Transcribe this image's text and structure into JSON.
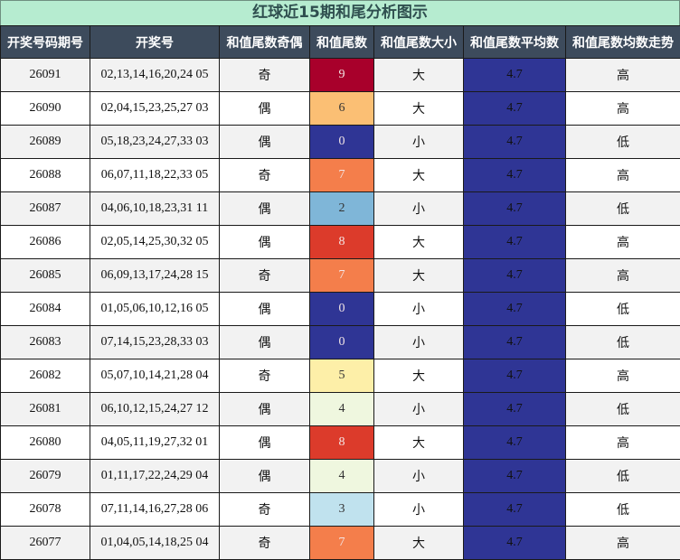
{
  "title": "红球近15期和尾分析图示",
  "headers": [
    "开奖号码期号",
    "开奖号",
    "和值尾数奇偶",
    "和值尾数",
    "和值尾数大小",
    "和值尾数平均数",
    "和值尾数均数走势"
  ],
  "colors": {
    "title_bg": "#b6ecd0",
    "header_bg": "#3d4b5c",
    "avg_bg": "#2f3595",
    "tail_scale": {
      "0": "#2f3595",
      "2": "#7fb6d8",
      "3": "#c0e2ee",
      "4": "#eff7df",
      "5": "#fdefa8",
      "6": "#fbbf74",
      "7": "#f47e4b",
      "8": "#dc3b2b",
      "9": "#a8002b"
    }
  },
  "rows": [
    {
      "issue": "26091",
      "numbers": "02,13,14,16,20,24 05",
      "parity": "奇",
      "tail": "9",
      "size": "大",
      "avg": "4.7",
      "trend": "高"
    },
    {
      "issue": "26090",
      "numbers": "02,04,15,23,25,27 03",
      "parity": "偶",
      "tail": "6",
      "size": "大",
      "avg": "4.7",
      "trend": "高"
    },
    {
      "issue": "26089",
      "numbers": "05,18,23,24,27,33 03",
      "parity": "偶",
      "tail": "0",
      "size": "小",
      "avg": "4.7",
      "trend": "低"
    },
    {
      "issue": "26088",
      "numbers": "06,07,11,18,22,33 05",
      "parity": "奇",
      "tail": "7",
      "size": "大",
      "avg": "4.7",
      "trend": "高"
    },
    {
      "issue": "26087",
      "numbers": "04,06,10,18,23,31 11",
      "parity": "偶",
      "tail": "2",
      "size": "小",
      "avg": "4.7",
      "trend": "低"
    },
    {
      "issue": "26086",
      "numbers": "02,05,14,25,30,32 05",
      "parity": "偶",
      "tail": "8",
      "size": "大",
      "avg": "4.7",
      "trend": "高"
    },
    {
      "issue": "26085",
      "numbers": "06,09,13,17,24,28 15",
      "parity": "奇",
      "tail": "7",
      "size": "大",
      "avg": "4.7",
      "trend": "高"
    },
    {
      "issue": "26084",
      "numbers": "01,05,06,10,12,16 05",
      "parity": "偶",
      "tail": "0",
      "size": "小",
      "avg": "4.7",
      "trend": "低"
    },
    {
      "issue": "26083",
      "numbers": "07,14,15,23,28,33 03",
      "parity": "偶",
      "tail": "0",
      "size": "小",
      "avg": "4.7",
      "trend": "低"
    },
    {
      "issue": "26082",
      "numbers": "05,07,10,14,21,28 04",
      "parity": "奇",
      "tail": "5",
      "size": "大",
      "avg": "4.7",
      "trend": "高"
    },
    {
      "issue": "26081",
      "numbers": "06,10,12,15,24,27 12",
      "parity": "偶",
      "tail": "4",
      "size": "小",
      "avg": "4.7",
      "trend": "低"
    },
    {
      "issue": "26080",
      "numbers": "04,05,11,19,27,32 01",
      "parity": "偶",
      "tail": "8",
      "size": "大",
      "avg": "4.7",
      "trend": "高"
    },
    {
      "issue": "26079",
      "numbers": "01,11,17,22,24,29 04",
      "parity": "偶",
      "tail": "4",
      "size": "小",
      "avg": "4.7",
      "trend": "低"
    },
    {
      "issue": "26078",
      "numbers": "07,11,14,16,27,28 06",
      "parity": "奇",
      "tail": "3",
      "size": "小",
      "avg": "4.7",
      "trend": "低"
    },
    {
      "issue": "26077",
      "numbers": "01,04,05,14,18,25 04",
      "parity": "奇",
      "tail": "7",
      "size": "大",
      "avg": "4.7",
      "trend": "高"
    }
  ]
}
